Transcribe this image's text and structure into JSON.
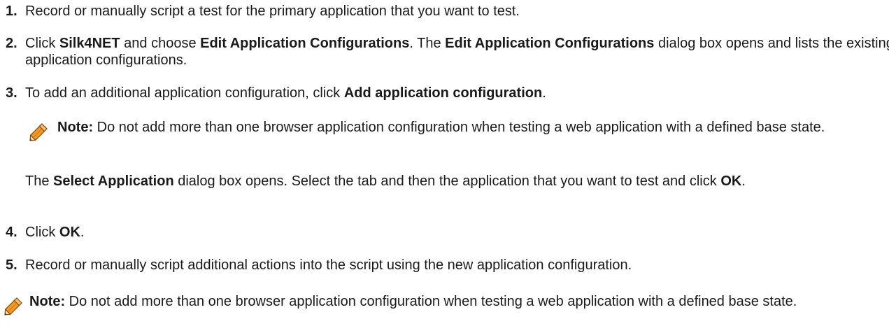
{
  "steps": [
    {
      "number": "1.",
      "text": "Record or manually script a test for the primary application that you want to test."
    },
    {
      "number": "2.",
      "t1": "Click ",
      "b1": "Silk4NET",
      "t2": " and choose ",
      "b2": "Edit Application Configurations",
      "t3": ". The ",
      "b3": "Edit Application Configurations",
      "t4": " dialog box opens and lists the existing application configurations."
    },
    {
      "number": "3.",
      "t1": "To add an additional application configuration, click ",
      "b1": "Add application configuration",
      "t2": ".",
      "note": {
        "label": "Note:",
        "text": " Do not add more than one browser application configuration when testing a web application with a defined base state."
      },
      "follow": {
        "t1": "The ",
        "b1": "Select Application",
        "t2": " dialog box opens. Select the tab and then the application that you want to test and click ",
        "b2": "OK",
        "t3": "."
      }
    },
    {
      "number": "4.",
      "t1": "Click ",
      "b1": "OK",
      "t2": "."
    },
    {
      "number": "5.",
      "text": "Record or manually script additional actions into the script using the new application configuration."
    }
  ],
  "bottom_note": {
    "label": "Note:",
    "text": " Do not add more than one browser application configuration when testing a web application with a defined base state."
  },
  "icons": {
    "note": "pencil-icon"
  },
  "colors": {
    "text": "#1a1a1a",
    "pencil_body": "#f29a1f",
    "pencil_outline": "#8a4a10"
  }
}
